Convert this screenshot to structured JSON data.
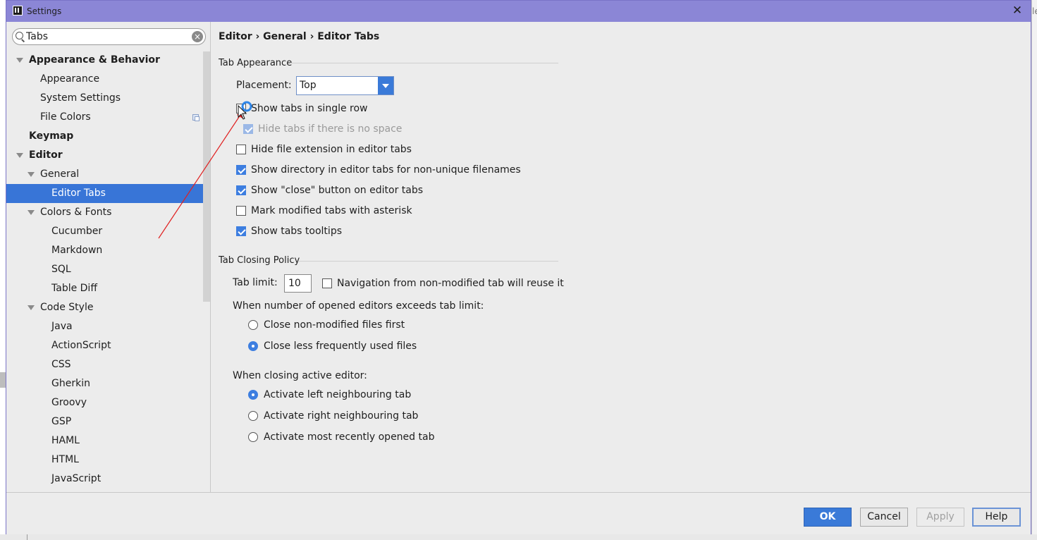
{
  "window": {
    "title": "Settings"
  },
  "search": {
    "value": "Tabs"
  },
  "tree": {
    "items": [
      {
        "label": "Appearance & Behavior"
      },
      {
        "label": "Appearance"
      },
      {
        "label": "System Settings"
      },
      {
        "label": "File Colors"
      },
      {
        "label": "Keymap"
      },
      {
        "label": "Editor"
      },
      {
        "label": "General"
      },
      {
        "label": "Editor Tabs"
      },
      {
        "label": "Colors & Fonts"
      },
      {
        "label": "Cucumber"
      },
      {
        "label": "Markdown"
      },
      {
        "label": "SQL"
      },
      {
        "label": "Table Diff"
      },
      {
        "label": "Code Style"
      },
      {
        "label": "Java"
      },
      {
        "label": "ActionScript"
      },
      {
        "label": "CSS"
      },
      {
        "label": "Gherkin"
      },
      {
        "label": "Groovy"
      },
      {
        "label": "GSP"
      },
      {
        "label": "HAML"
      },
      {
        "label": "HTML"
      },
      {
        "label": "JavaScript"
      }
    ]
  },
  "breadcrumb": {
    "text": "Editor › General › Editor Tabs"
  },
  "tab_appearance": {
    "title": "Tab Appearance",
    "placement_label": "Placement:",
    "placement_value": "Top",
    "options": [
      {
        "label": "Show tabs in single row",
        "checked": false
      },
      {
        "label": "Hide tabs if there is no space",
        "checked": true,
        "disabled": true
      },
      {
        "label": "Hide file extension in editor tabs",
        "checked": false
      },
      {
        "label": "Show directory in editor tabs for non-unique filenames",
        "checked": true
      },
      {
        "label": "Show \"close\" button on editor tabs",
        "checked": true
      },
      {
        "label": "Mark modified tabs with asterisk",
        "checked": false
      },
      {
        "label": "Show tabs tooltips",
        "checked": true
      }
    ]
  },
  "tab_closing": {
    "title": "Tab Closing Policy",
    "tab_limit_label": "Tab limit:",
    "tab_limit_value": "10",
    "reuse_label": "Navigation from non-modified tab will reuse it",
    "exceeds_label": "When number of opened editors exceeds tab limit:",
    "exceeds_options": [
      {
        "label": "Close non-modified files first",
        "checked": false
      },
      {
        "label": "Close less frequently used files",
        "checked": true
      }
    ],
    "closing_label": "When closing active editor:",
    "closing_options": [
      {
        "label": "Activate left neighbouring tab",
        "checked": true
      },
      {
        "label": "Activate right neighbouring tab",
        "checked": false
      },
      {
        "label": "Activate most recently opened tab",
        "checked": false
      }
    ]
  },
  "buttons": {
    "ok": "OK",
    "cancel": "Cancel",
    "apply": "Apply",
    "help": "Help"
  },
  "background": {
    "right_edge_text": "le"
  },
  "colors": {
    "titlebar": "#8b86d6",
    "selection": "#3875d7",
    "accent": "#3a7ad8",
    "annotation": "#e02020"
  }
}
